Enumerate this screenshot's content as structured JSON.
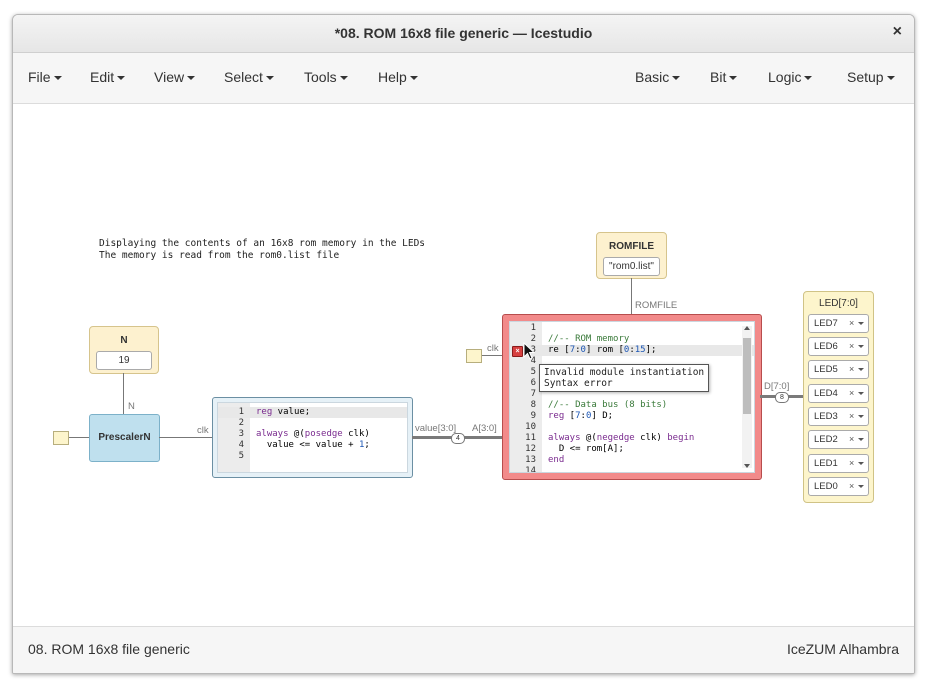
{
  "window": {
    "title": "*08. ROM 16x8 file generic — Icestudio",
    "close_label": "×"
  },
  "menu": {
    "left": [
      "File",
      "Edit",
      "View",
      "Select",
      "Tools",
      "Help"
    ],
    "right": [
      "Basic",
      "Bit",
      "Logic",
      "Setup"
    ]
  },
  "canvas": {
    "info_text": "Displaying the contents of an 16x8 rom memory in the LEDs\nThe memory is read from the rom0.list file",
    "n_const": {
      "name": "N",
      "value": "19"
    },
    "n_port_label": "N",
    "prescaler": {
      "label": "PrescalerN",
      "clk_label": "clk"
    },
    "counter_code": {
      "lines": [
        {
          "n": "1",
          "code": "reg value;"
        },
        {
          "n": "2",
          "code": ""
        },
        {
          "n": "3",
          "code": "always @(posedge clk)"
        },
        {
          "n": "4",
          "code": "  value <= value + 1;"
        },
        {
          "n": "5",
          "code": ""
        }
      ]
    },
    "value_label": "value[3:0]",
    "value_bus_width": "4",
    "a_label": "A[3:0]",
    "clk_label": "clk",
    "romfile": {
      "name": "ROMFILE",
      "value": "\"rom0.list\"",
      "port_label": "ROMFILE"
    },
    "rom_code": {
      "lines": [
        {
          "n": "1",
          "code": ""
        },
        {
          "n": "2",
          "code": "//-- ROM memory"
        },
        {
          "n": "3",
          "code": "re [7:0] rom [0:15];"
        },
        {
          "n": "4",
          "code": ""
        },
        {
          "n": "5",
          "code": ""
        },
        {
          "n": "6",
          "code": ""
        },
        {
          "n": "7",
          "code": ""
        },
        {
          "n": "8",
          "code": "//-- Data bus (8 bits)"
        },
        {
          "n": "9",
          "code": "reg [7:0] D;"
        },
        {
          "n": "10",
          "code": ""
        },
        {
          "n": "11",
          "code": "always @(negedge clk) begin"
        },
        {
          "n": "12",
          "code": "  D <= rom[A];"
        },
        {
          "n": "13",
          "code": "end"
        },
        {
          "n": "14",
          "code": ""
        }
      ],
      "error_tooltip": "Invalid module instantiation\nSyntax error"
    },
    "d_label": "D[7:0]",
    "d_bus_width": "8",
    "led_panel": {
      "title": "LED[7:0]",
      "items": [
        "LED7",
        "LED6",
        "LED5",
        "LED4",
        "LED3",
        "LED2",
        "LED1",
        "LED0"
      ],
      "remove_label": "×"
    }
  },
  "status": {
    "left": "08. ROM 16x8 file generic",
    "right": "IceZUM Alhambra"
  },
  "colors": {
    "error_block": "#f28a8a",
    "code_block": "#e6f1f7",
    "constant": "#fdf1cf",
    "module": "#bfe0ee"
  }
}
